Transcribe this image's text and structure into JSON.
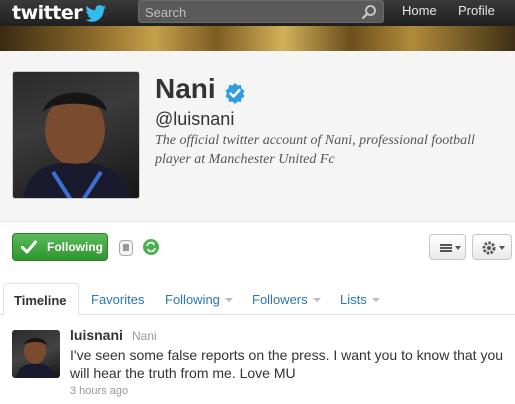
{
  "topbar": {
    "logo_text": "twitter",
    "search_placeholder": "Search",
    "nav": {
      "home": "Home",
      "profile": "Profile"
    }
  },
  "profile": {
    "name": "Nani",
    "verified": true,
    "handle": "@luisnani",
    "bio_line1": "The official twitter account of Nani, professional football",
    "bio_line2": "player at Manchester United Fc"
  },
  "actions": {
    "follow_label": "Following",
    "icons": [
      "device-icon",
      "retweet-icon",
      "list-icon",
      "gear-icon"
    ]
  },
  "tabs": [
    {
      "label": "Timeline",
      "active": true,
      "dropdown": false
    },
    {
      "label": "Favorites",
      "active": false,
      "dropdown": false
    },
    {
      "label": "Following",
      "active": false,
      "dropdown": true
    },
    {
      "label": "Followers",
      "active": false,
      "dropdown": true
    },
    {
      "label": "Lists",
      "active": false,
      "dropdown": true
    }
  ],
  "tweet": {
    "username": "luisnani",
    "display_name": "Nani",
    "text": "I've seen some false reports on the press. I want you to know that you will hear the truth from me. Love MU",
    "time": "3 hours ago"
  },
  "colors": {
    "topbar": "#2a2a2a",
    "link": "#2a77b3",
    "follow_green": "#3ea43e",
    "verified_blue": "#2f9ce0"
  }
}
